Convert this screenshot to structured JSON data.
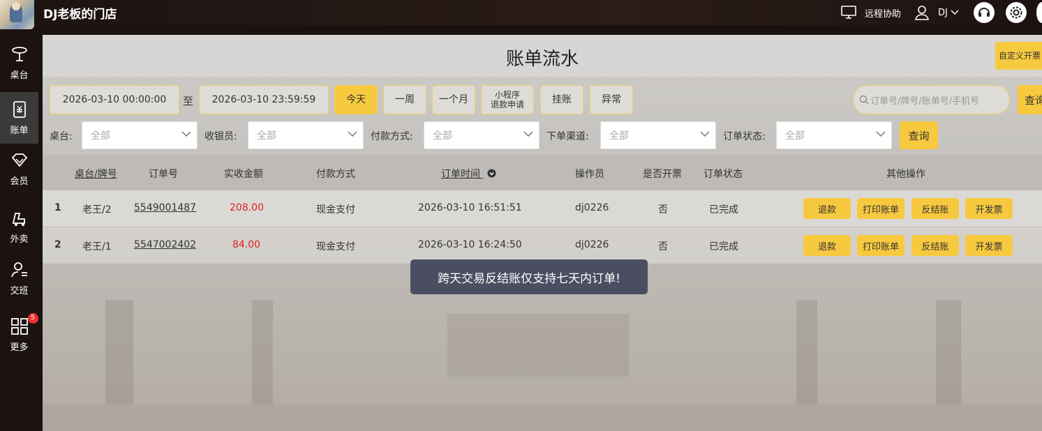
{
  "topbar": {
    "shop_name": "DJ老板的门店",
    "remote_label": "远程协助",
    "user_label": "DJ"
  },
  "sidebar": {
    "items": [
      {
        "label": "桌台",
        "icon": "table-icon"
      },
      {
        "label": "账单",
        "icon": "bill-icon"
      },
      {
        "label": "会员",
        "icon": "member-icon"
      },
      {
        "label": "外卖",
        "icon": "takeout-icon"
      },
      {
        "label": "交班",
        "icon": "shift-icon"
      },
      {
        "label": "更多",
        "icon": "grid-icon",
        "badge": "5"
      }
    ]
  },
  "header": {
    "title": "账单流水",
    "custom_button": "自定义开票"
  },
  "filters": {
    "start_date": "2026-03-10 00:00:00",
    "to_label": "至",
    "end_date": "2026-03-10 23:59:59",
    "quick": [
      "今天",
      "一周",
      "一个月",
      "小程序",
      "退款申请",
      "挂账",
      "异常"
    ],
    "search_placeholder": "订单号/牌号/账单号/手机号",
    "search_button": "查询",
    "table_label": "桌台:",
    "cashier_label": "收银员:",
    "pay_label": "付款方式:",
    "channel_label": "下单渠道:",
    "status_label": "订单状态:",
    "all": "全部",
    "query_button": "查询"
  },
  "table": {
    "headers": [
      "桌台/牌号",
      "订单号",
      "实收金额",
      "付款方式",
      "订单时间",
      "操作员",
      "是否开票",
      "订单状态",
      "其他操作"
    ],
    "rows": [
      {
        "no": "1",
        "table": "老王/2",
        "order": "5549001487",
        "amount": "208.00",
        "pay": "现金支付",
        "time": "2026-03-10 16:51:51",
        "operator": "dj0226",
        "invoiced": "否",
        "status": "已完成"
      },
      {
        "no": "2",
        "table": "老王/1",
        "order": "5547002402",
        "amount": "84.00",
        "pay": "现金支付",
        "time": "2026-03-10 16:24:50",
        "operator": "dj0226",
        "invoiced": "否",
        "status": "已完成"
      }
    ],
    "actions": [
      "退款",
      "打印账单",
      "反结账",
      "开发票"
    ]
  },
  "toast": "跨天交易反结账仅支持七天内订单!",
  "colors": {
    "accent": "#f7c93f",
    "amount": "#e02020",
    "toast_bg": "#4b4e61"
  }
}
